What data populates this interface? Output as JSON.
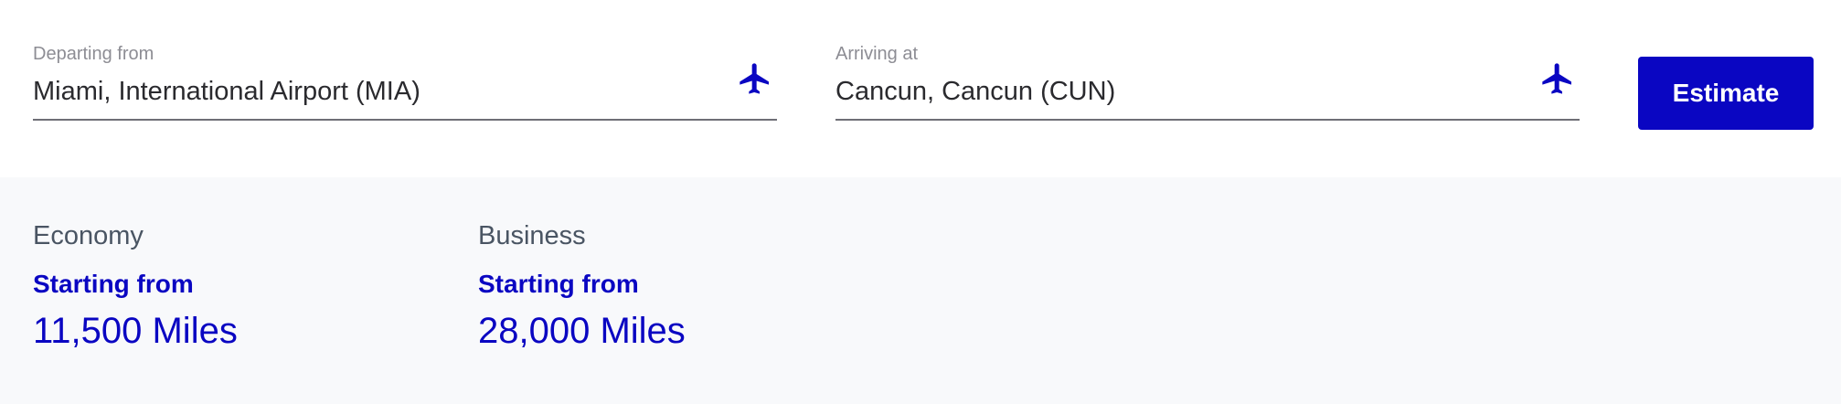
{
  "search": {
    "departure": {
      "label": "Departing from",
      "value": "Miami, International Airport (MIA)",
      "icon": "airplane-icon"
    },
    "arrival": {
      "label": "Arriving at",
      "value": "Cancun, Cancun (CUN)",
      "icon": "airplane-icon"
    },
    "estimate_label": "Estimate"
  },
  "results": {
    "economy": {
      "name": "Economy",
      "prefix": "Starting from",
      "miles": "11,500 Miles"
    },
    "business": {
      "name": "Business",
      "prefix": "Starting from",
      "miles": "28,000 Miles"
    }
  },
  "colors": {
    "accent": "#0a06c2",
    "results_background": "#f8f9fb",
    "label_gray": "#8d8d94",
    "text_dark": "#2a2a2e"
  }
}
